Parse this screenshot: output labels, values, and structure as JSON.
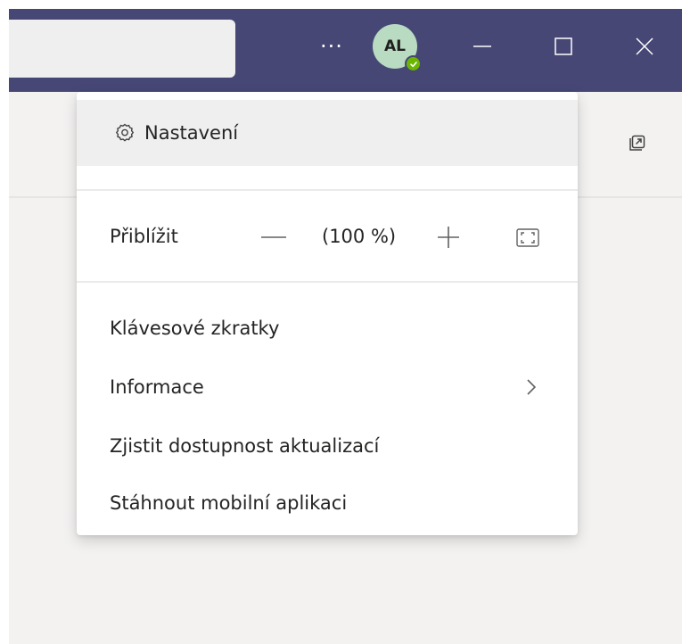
{
  "titlebar": {
    "more_label": "···",
    "avatar_initials": "AL",
    "presence": "available",
    "accent_color": "#464775"
  },
  "menu": {
    "settings_label": "Nastavení",
    "zoom_label": "Přiblížit",
    "zoom_level": "(100 %)",
    "items": [
      {
        "label": "Klávesové zkratky"
      },
      {
        "label": "Informace"
      },
      {
        "label": "Zjistit dostupnost aktualizací"
      },
      {
        "label": "Stáhnout mobilní aplikaci"
      }
    ]
  },
  "icons": [
    "gear-icon",
    "zoom-out-icon",
    "zoom-in-icon",
    "fullscreen-icon",
    "chevron-right-icon",
    "popout-icon",
    "minimize-icon",
    "maximize-icon",
    "close-icon"
  ]
}
